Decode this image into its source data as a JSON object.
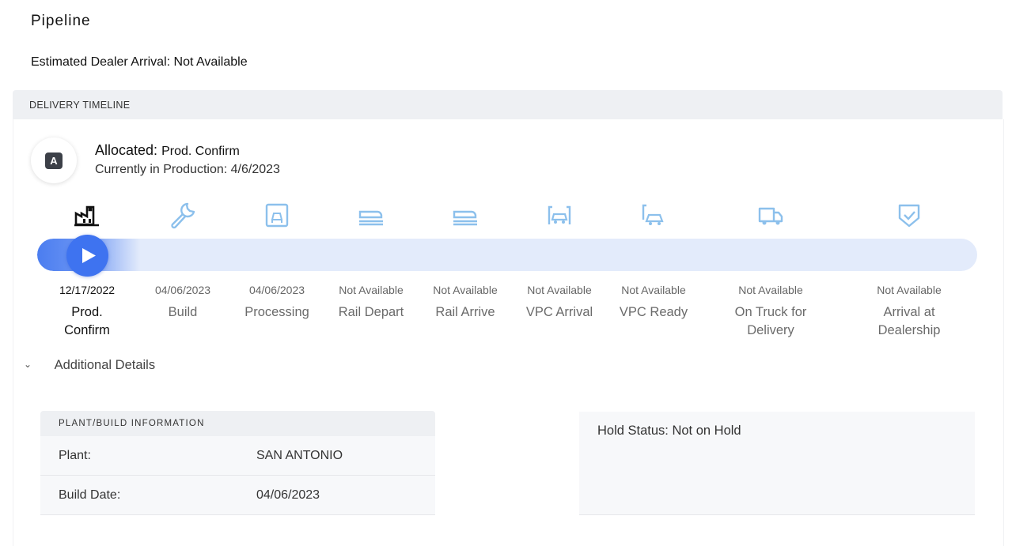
{
  "page": {
    "title": "Pipeline",
    "estimated_arrival": "Estimated Dealer Arrival: Not Available"
  },
  "timeline": {
    "header": "DELIVERY TIMELINE",
    "avatar_letter": "A",
    "status_label": "Allocated:",
    "status_value": "Prod. Confirm",
    "current_text": "Currently in Production: 4/6/2023",
    "progress_fraction": 0.05,
    "stages": [
      {
        "icon": "factory-icon",
        "date": "12/17/2022",
        "name": "Prod.\nConfirm",
        "active": true
      },
      {
        "icon": "wrench-icon",
        "date": "04/06/2023",
        "name": "Build",
        "active": false
      },
      {
        "icon": "processing-icon",
        "date": "04/06/2023",
        "name": "Processing",
        "active": false
      },
      {
        "icon": "rail-depart-icon",
        "date": "Not Available",
        "name": "Rail Depart",
        "active": false
      },
      {
        "icon": "rail-arrive-icon",
        "date": "Not Available",
        "name": "Rail Arrive",
        "active": false
      },
      {
        "icon": "vpc-arrival-icon",
        "date": "Not Available",
        "name": "VPC Arrival",
        "active": false
      },
      {
        "icon": "vpc-ready-icon",
        "date": "Not Available",
        "name": "VPC Ready",
        "active": false
      },
      {
        "icon": "truck-icon",
        "date": "Not Available",
        "name": "On Truck for\nDelivery",
        "active": false
      },
      {
        "icon": "shield-check-icon",
        "date": "Not Available",
        "name": "Arrival at\nDealership",
        "active": false
      }
    ]
  },
  "details": {
    "toggle_label": "Additional Details",
    "plant_header": "PLANT/BUILD INFORMATION",
    "plant_rows": [
      {
        "label": "Plant:",
        "value": "SAN ANTONIO"
      },
      {
        "label": "Build Date:",
        "value": "04/06/2023"
      }
    ],
    "hold_status": "Hold Status: Not on Hold"
  },
  "colors": {
    "accent": "#3e73f0",
    "icon_inactive": "#8cc0ec",
    "track": "#e3ebfb"
  }
}
